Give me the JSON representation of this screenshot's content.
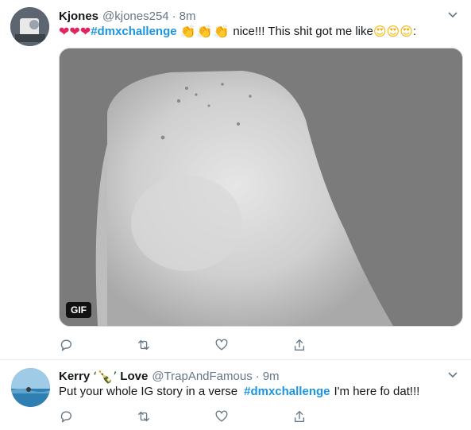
{
  "tweets": [
    {
      "name": "Kjones",
      "handle": "@kjones254",
      "separator": "·",
      "time": "8m",
      "text": {
        "prefix_emoji": "❤❤❤",
        "hashtag": "#dmxchallenge",
        "mid_emoji": "👏👏👏",
        "body": "nice!!! This shit got me like",
        "suffix_emoji": "😍😍😍",
        "tail": ":"
      },
      "media": {
        "badge": "GIF"
      }
    },
    {
      "name": "Kerry",
      "name_emoji": "‘🍾’",
      "name_suffix": "Love",
      "handle": "@TrapAndFamous",
      "separator": "·",
      "time": "9m",
      "text": {
        "body": "Put your whole IG story in a verse",
        "hashtag": "#dmxchallenge",
        "tail": "I'm here fo dat!!!"
      }
    }
  ],
  "icons": [
    "reply-icon",
    "retweet-icon",
    "like-icon",
    "share-icon",
    "chevron-down-icon"
  ],
  "colors": {
    "hashtag": "#1b95e0",
    "secondary": "#657786",
    "divider": "#e6ecf0",
    "icon": "#657786"
  }
}
